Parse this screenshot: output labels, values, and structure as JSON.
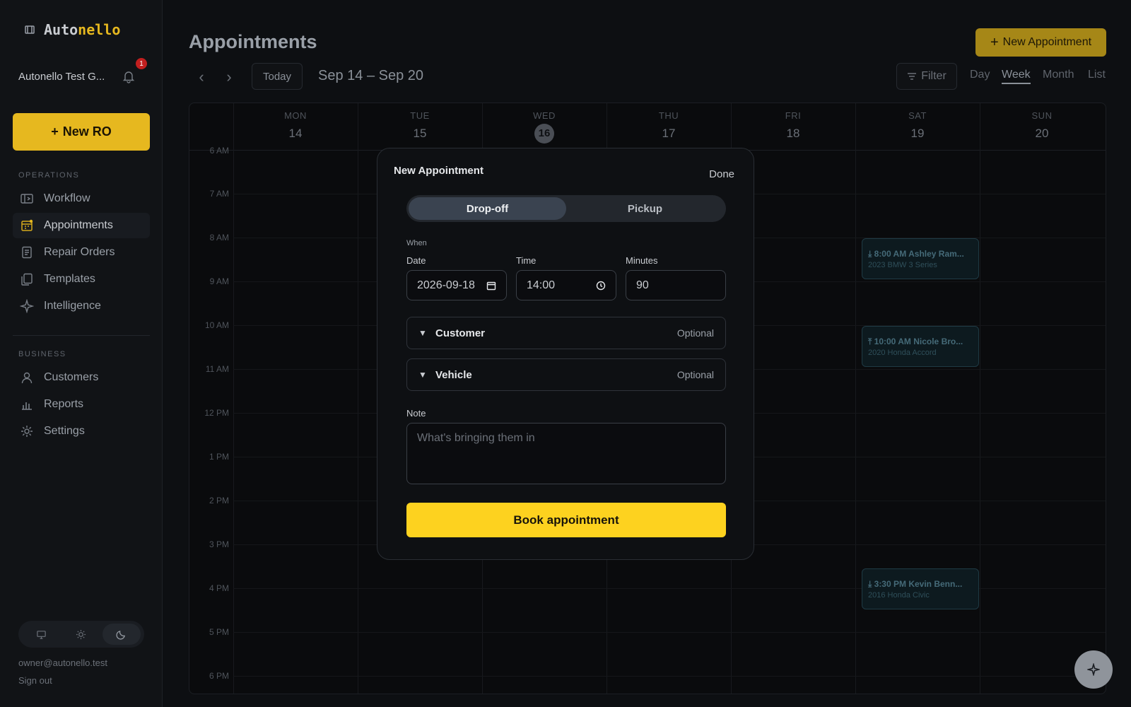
{
  "app": {
    "logo_part1": "Auto",
    "logo_part2": "nello",
    "org_name": "Autonello Test G...",
    "notification_count": "1"
  },
  "sidebar": {
    "new_ro_label": "New RO",
    "operations_label": "OPERATIONS",
    "operations": [
      {
        "label": "Workflow",
        "icon": "workflow-icon"
      },
      {
        "label": "Appointments",
        "icon": "calendar-icon",
        "active": true
      },
      {
        "label": "Repair Orders",
        "icon": "document-icon"
      },
      {
        "label": "Templates",
        "icon": "templates-icon"
      },
      {
        "label": "Intelligence",
        "icon": "sparkle-icon"
      }
    ],
    "business_label": "BUSINESS",
    "business": [
      {
        "label": "Customers",
        "icon": "user-icon"
      },
      {
        "label": "Reports",
        "icon": "chart-icon"
      },
      {
        "label": "Settings",
        "icon": "gear-icon"
      }
    ],
    "email": "owner@autonello.test",
    "sign_out": "Sign out"
  },
  "header": {
    "title": "Appointments",
    "new_appointment": "New Appointment",
    "today": "Today",
    "range": "Sep 14 – Sep 20",
    "filter": "Filter",
    "views": [
      "Day",
      "Week",
      "Month",
      "List"
    ],
    "active_view": "Week"
  },
  "calendar": {
    "days": [
      {
        "name": "MON",
        "date": "14"
      },
      {
        "name": "TUE",
        "date": "15"
      },
      {
        "name": "WED",
        "date": "16",
        "today": true
      },
      {
        "name": "THU",
        "date": "17"
      },
      {
        "name": "FRI",
        "date": "18"
      },
      {
        "name": "SAT",
        "date": "19"
      },
      {
        "name": "SUN",
        "date": "20"
      }
    ],
    "hours": [
      "6 AM",
      "7 AM",
      "8 AM",
      "9 AM",
      "10 AM",
      "11 AM",
      "12 PM",
      "1 PM",
      "2 PM",
      "3 PM",
      "4 PM",
      "5 PM",
      "6 PM"
    ],
    "events": [
      {
        "title": "8:00 AM Ashley Ram...",
        "subtitle": "2023 BMW 3 Series",
        "type": "drop-off"
      },
      {
        "title": "10:00 AM Nicole Bro...",
        "subtitle": "2020 Honda Accord",
        "type": "pickup"
      },
      {
        "title": "3:30 PM Kevin Benn...",
        "subtitle": "2016 Honda Civic",
        "type": "drop-off"
      }
    ]
  },
  "modal": {
    "title": "New Appointment",
    "done": "Done",
    "segments": [
      "Drop-off",
      "Pickup"
    ],
    "when_label": "When",
    "date_label": "Date",
    "date_value": "2026-09-18",
    "time_label": "Time",
    "time_value": "14:00",
    "minutes_label": "Minutes",
    "minutes_value": "90",
    "customer_label": "Customer",
    "vehicle_label": "Vehicle",
    "optional": "Optional",
    "note_label": "Note",
    "note_placeholder": "What's bringing them in",
    "book_label": "Book appointment"
  },
  "colors": {
    "accent": "#fdd21f",
    "accent_dim": "#a68717",
    "badge": "#c21f1f"
  }
}
